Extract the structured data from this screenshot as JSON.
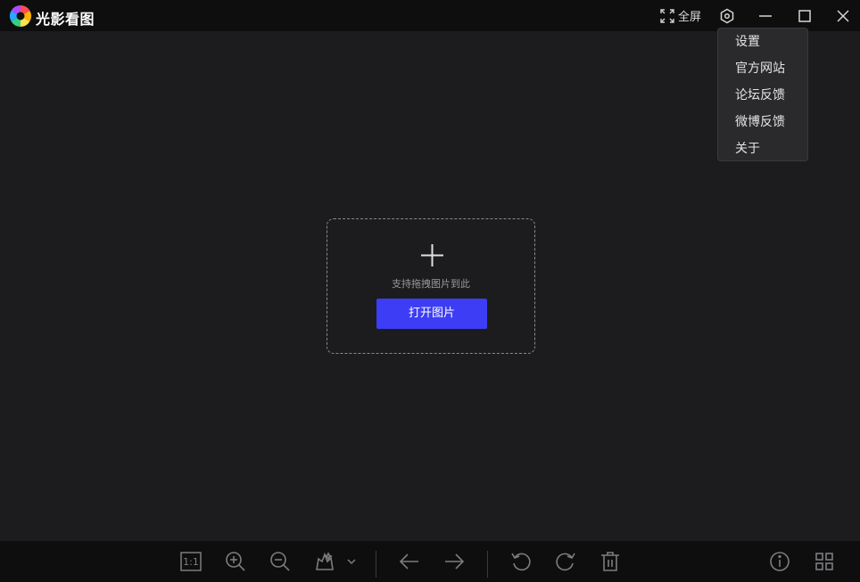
{
  "app": {
    "title": "光影看图"
  },
  "titlebar": {
    "fullscreen_label": "全屏"
  },
  "settings_menu": {
    "items": [
      "设置",
      "官方网站",
      "论坛反馈",
      "微博反馈",
      "关于"
    ]
  },
  "dropzone": {
    "hint": "支持拖拽图片到此",
    "open_button": "打开图片"
  },
  "toolbar": {
    "actual_size_label": "1:1",
    "icons": [
      "actual-size-icon",
      "zoom-in-icon",
      "zoom-out-icon",
      "magic-edit-icon",
      "chevron-down-icon",
      "arrow-left-icon",
      "arrow-right-icon",
      "rotate-left-icon",
      "rotate-right-icon",
      "trash-icon",
      "info-icon",
      "grid-icon"
    ]
  },
  "colors": {
    "background": "#1c1c1e",
    "bar": "#0e0e0f",
    "accent": "#3d3df5",
    "menu": "#2a2a2d"
  }
}
